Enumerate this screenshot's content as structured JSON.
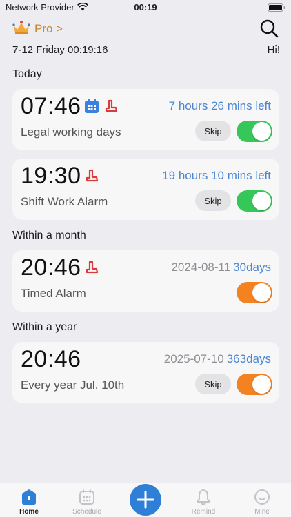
{
  "status_bar": {
    "carrier": "Network Provider",
    "time": "00:19"
  },
  "header": {
    "pro_label": "Pro >",
    "datetime": "7-12 Friday 00:19:16",
    "greeting": "Hi!"
  },
  "sections": [
    {
      "title": "Today",
      "alarms": [
        {
          "time": "07:46",
          "right": "7 hours 26 mins left",
          "label": "Legal working days",
          "skip": "Skip",
          "toggle_color": "#36c759"
        },
        {
          "time": "19:30",
          "right": "19 hours 10 mins left",
          "label": "Shift Work Alarm",
          "skip": "Skip",
          "toggle_color": "#36c759"
        }
      ]
    },
    {
      "title": "Within a month",
      "alarms": [
        {
          "time": "20:46",
          "date": "2024-08-11",
          "right": "30days",
          "label": "Timed Alarm",
          "toggle_color": "#f58220"
        }
      ]
    },
    {
      "title": "Within a year",
      "alarms": [
        {
          "time": "20:46",
          "date": "2025-07-10",
          "right": "363days",
          "label": "Every year Jul. 10th",
          "skip": "Skip",
          "toggle_color": "#f58220"
        }
      ]
    }
  ],
  "tabbar": {
    "home": "Home",
    "schedule": "Schedule",
    "remind": "Remind",
    "mine": "Mine"
  },
  "colors": {
    "accent": "#4a86d1",
    "pro": "#c9882c",
    "fab": "#2f7fd6"
  }
}
